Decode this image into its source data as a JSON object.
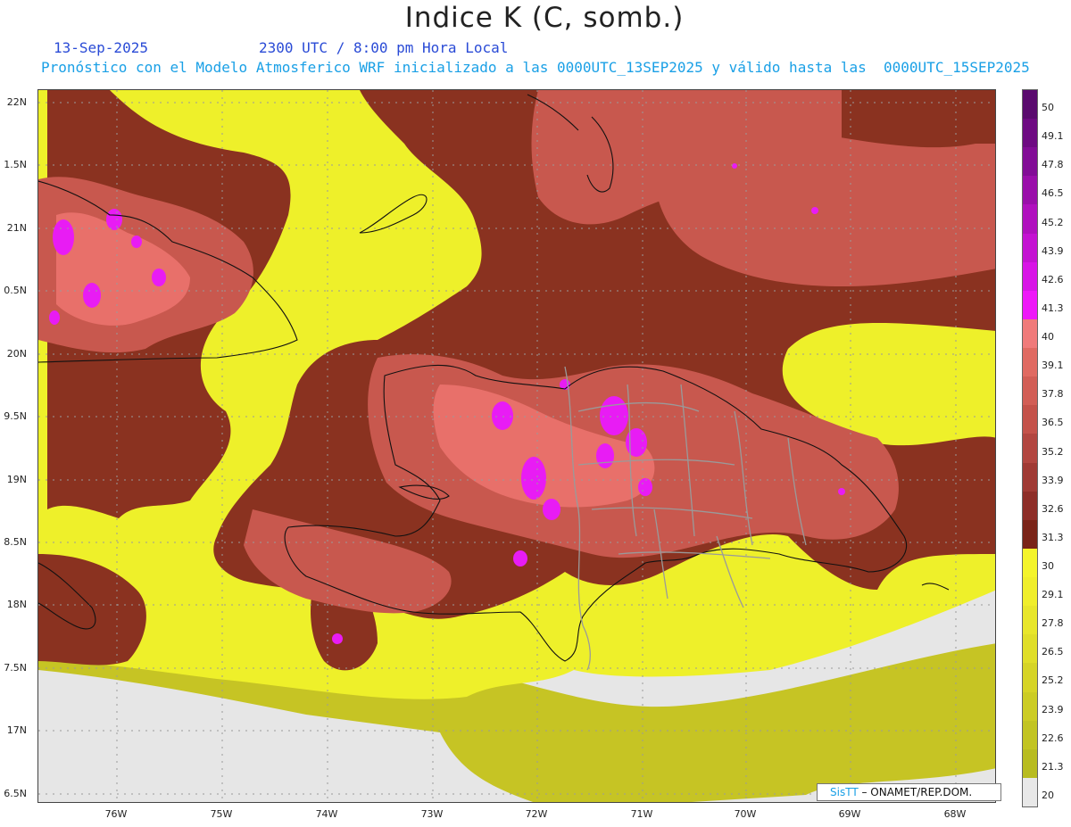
{
  "title": "Indice K (C, somb.)",
  "date": "13-Sep-2025",
  "time": "2300 UTC / 8:00 pm Hora Local",
  "model_info": "Pronóstico con el Modelo Atmosferico WRF inicializado a las 0000UTC_13SEP2025 y válido hasta las  0000UTC_15SEP2025",
  "credit": {
    "brand": "SisTT",
    "text": " – ONAMET/REP.DOM."
  },
  "lat_labels": [
    "22N",
    "1.5N",
    "21N",
    "0.5N",
    "20N",
    "9.5N",
    "19N",
    "8.5N",
    "18N",
    "7.5N",
    "17N",
    "6.5N"
  ],
  "lon_labels": [
    "76W",
    "75W",
    "74W",
    "73W",
    "72W",
    "71W",
    "70W",
    "69W",
    "68W"
  ],
  "colorbar": {
    "labels": [
      "50",
      "49.1",
      "47.8",
      "46.5",
      "45.2",
      "43.9",
      "42.6",
      "41.3",
      "40",
      "39.1",
      "37.8",
      "36.5",
      "35.2",
      "33.9",
      "32.6",
      "31.3",
      "30",
      "29.1",
      "27.8",
      "26.5",
      "25.2",
      "23.9",
      "22.6",
      "21.3",
      "20"
    ],
    "colors": [
      "#5a0a6e",
      "#6e0a82",
      "#820c96",
      "#9a0eaa",
      "#b010be",
      "#c412d2",
      "#d814e6",
      "#ee18f8",
      "#f07a7a",
      "#e06a62",
      "#d25e56",
      "#c4524a",
      "#b24640",
      "#a03a34",
      "#8e2e28",
      "#7a2418",
      "#f4f42a",
      "#f0ee2a",
      "#e8e62a",
      "#e0de28",
      "#d6d426",
      "#cccc24",
      "#c2c422",
      "#b8bc20",
      "#e8e8e8"
    ]
  },
  "palette": {
    "sea_low": "#e6e6e6",
    "olive": "#c6c424",
    "yellow": "#eef02a",
    "brown": "#8a3220",
    "salmon": "#c8584e",
    "pink": "#e8706a",
    "magenta": "#e81cf4",
    "coast": "#111111",
    "border": "#9a9a9a"
  }
}
